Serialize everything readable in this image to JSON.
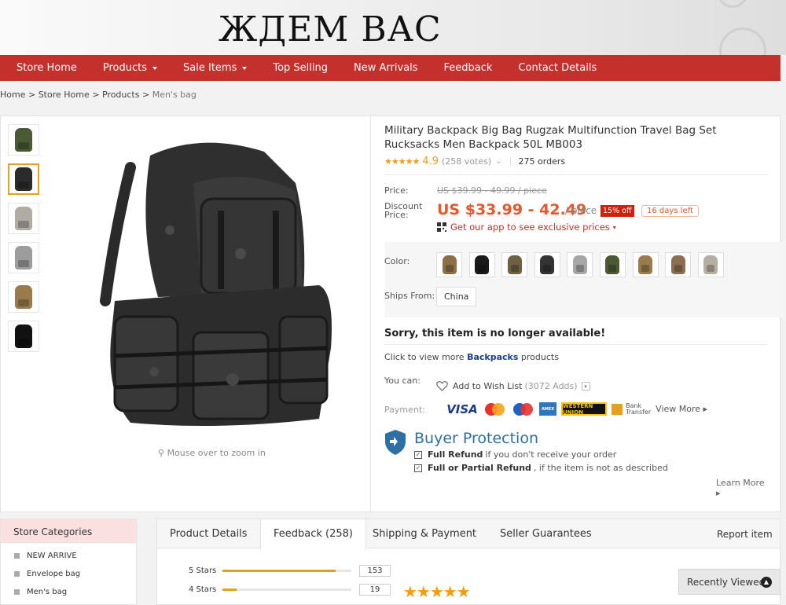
{
  "banner": {
    "text": "ЖДЕМ ВАС"
  },
  "nav": {
    "items": [
      {
        "label": "Store Home",
        "dropdown": false
      },
      {
        "label": "Products",
        "dropdown": true
      },
      {
        "label": "Sale Items",
        "dropdown": true
      },
      {
        "label": "Top Selling",
        "dropdown": false
      },
      {
        "label": "New Arrivals",
        "dropdown": false
      },
      {
        "label": "Feedback",
        "dropdown": false
      },
      {
        "label": "Contact Details",
        "dropdown": false
      }
    ]
  },
  "breadcrumb": {
    "home": "Home",
    "store": "Store Home",
    "products": "Products",
    "current": "Men's bag",
    "sep": ">"
  },
  "gallery": {
    "thumb_colors": [
      "#4a5a35",
      "#2b2b2b",
      "#b0aca4",
      "#9c9c9c",
      "#9a7b4d",
      "#111111"
    ],
    "selected_index": 1,
    "zoom_hint": "Mouse over to zoom in"
  },
  "product": {
    "title": "Military Backpack Big Bag Rugzak Multifunction Travel Bag Set Rucksacks Men Backpack 50L MB003",
    "stars": "★★★★★",
    "rating": "4.9",
    "votes": "(258 votes)",
    "orders": "275 orders",
    "price_label": "Price:",
    "old_price": "US $39.99 - 49.99 / piece",
    "discount_label_1": "Discount",
    "discount_label_2": "Price:",
    "price": "US $33.99 - 42.49",
    "per_piece": "/ piece",
    "off_badge": "15% off",
    "days_left": "16 days left",
    "app_link": "Get our app to see exclusive prices",
    "color_label": "Color:",
    "swatch_colors": [
      "#8a6f47",
      "#1a1a1a",
      "#6e6142",
      "#333333",
      "#a6a6a6",
      "#4b5a32",
      "#9a7b4d",
      "#8c6f52",
      "#b5aea3"
    ],
    "ships_label": "Ships From:",
    "ships_value": "China",
    "unavailable": "Sorry, this item is no longer available!",
    "more_prefix": "Click to view more",
    "more_category": "Backpacks",
    "more_suffix": "products",
    "you_can_label": "You can:",
    "wishlist": "Add to Wish List",
    "wishlist_count": "(3072 Adds)",
    "payment_label": "Payment:",
    "payments": {
      "visa": "VISA",
      "wu": "WESTERN UNION",
      "bank_1": "Bank",
      "bank_2": "Transfer",
      "view_more": "View More ▸"
    },
    "brand_colors": {
      "price": "#e8562a",
      "nav": "#c4302b",
      "link": "#1a3f8a",
      "protect": "#2e6fa4"
    }
  },
  "protection": {
    "title": "Buyer Protection",
    "line1_bold": "Full Refund",
    "line1_rest": "if you don't receive your order",
    "line2_bold": "Full or Partial Refund",
    "line2_rest": ", if the item is not as described",
    "learn_more": "Learn More ▸"
  },
  "categories": {
    "title": "Store Categories",
    "items": [
      "NEW ARRIVE",
      "Envelope bag",
      "Men's bag"
    ]
  },
  "tabs": {
    "items": [
      "Product Details",
      "Feedback (258)",
      "Shipping & Payment",
      "Seller Guarantees"
    ],
    "active_index": 1,
    "report": "Report item"
  },
  "feedback": {
    "rows": [
      {
        "name": "5 Stars",
        "count": "153",
        "fraction": 0.88
      },
      {
        "name": "4 Stars",
        "count": "19",
        "fraction": 0.11
      }
    ],
    "big_stars": "★★★★★"
  },
  "recent": {
    "label": "Recently Viewed"
  }
}
